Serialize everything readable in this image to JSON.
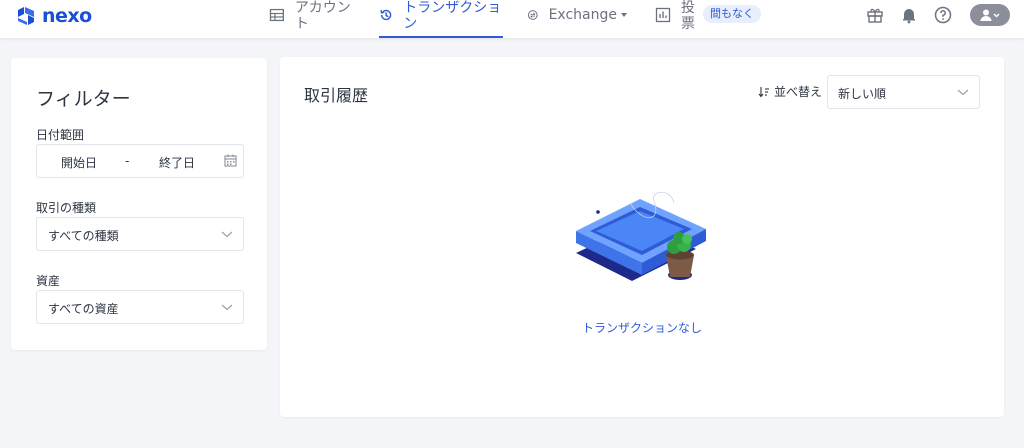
{
  "brand": {
    "name": "nexo",
    "color": "#1a4fd6"
  },
  "nav": {
    "account": {
      "label": "アカウント",
      "icon": "table-icon"
    },
    "transactions": {
      "label": "トランザクション",
      "icon": "history-icon"
    },
    "exchange": {
      "label": "Exchange",
      "icon": "exchange-icon"
    },
    "vote": {
      "label": "投票",
      "icon": "chart-icon",
      "badge": "間もなく"
    }
  },
  "header_icons": [
    "gift-icon",
    "bell-icon",
    "help-icon",
    "user-icon"
  ],
  "filters": {
    "title": "フィルター",
    "date_range": {
      "label": "日付範囲",
      "start_placeholder": "開始日",
      "separator": "-",
      "end_placeholder": "終了日"
    },
    "type": {
      "label": "取引の種類",
      "value": "すべての種類"
    },
    "asset": {
      "label": "資産",
      "value": "すべての資産"
    }
  },
  "history": {
    "title": "取引履歴",
    "sort_label": "並べ替え",
    "sort_value": "新しい順",
    "empty_message": "トランザクションなし"
  },
  "colors": {
    "accent": "#2f5bd6",
    "background": "#f4f5f8",
    "card": "#ffffff"
  }
}
